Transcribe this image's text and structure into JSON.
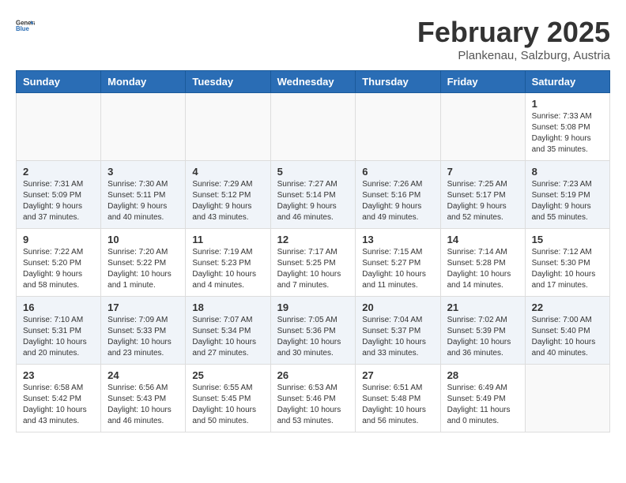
{
  "header": {
    "logo_general": "General",
    "logo_blue": "Blue",
    "title": "February 2025",
    "subtitle": "Plankenau, Salzburg, Austria"
  },
  "weekdays": [
    "Sunday",
    "Monday",
    "Tuesday",
    "Wednesday",
    "Thursday",
    "Friday",
    "Saturday"
  ],
  "weeks": [
    [
      {
        "day": "",
        "info": ""
      },
      {
        "day": "",
        "info": ""
      },
      {
        "day": "",
        "info": ""
      },
      {
        "day": "",
        "info": ""
      },
      {
        "day": "",
        "info": ""
      },
      {
        "day": "",
        "info": ""
      },
      {
        "day": "1",
        "info": "Sunrise: 7:33 AM\nSunset: 5:08 PM\nDaylight: 9 hours and 35 minutes."
      }
    ],
    [
      {
        "day": "2",
        "info": "Sunrise: 7:31 AM\nSunset: 5:09 PM\nDaylight: 9 hours and 37 minutes."
      },
      {
        "day": "3",
        "info": "Sunrise: 7:30 AM\nSunset: 5:11 PM\nDaylight: 9 hours and 40 minutes."
      },
      {
        "day": "4",
        "info": "Sunrise: 7:29 AM\nSunset: 5:12 PM\nDaylight: 9 hours and 43 minutes."
      },
      {
        "day": "5",
        "info": "Sunrise: 7:27 AM\nSunset: 5:14 PM\nDaylight: 9 hours and 46 minutes."
      },
      {
        "day": "6",
        "info": "Sunrise: 7:26 AM\nSunset: 5:16 PM\nDaylight: 9 hours and 49 minutes."
      },
      {
        "day": "7",
        "info": "Sunrise: 7:25 AM\nSunset: 5:17 PM\nDaylight: 9 hours and 52 minutes."
      },
      {
        "day": "8",
        "info": "Sunrise: 7:23 AM\nSunset: 5:19 PM\nDaylight: 9 hours and 55 minutes."
      }
    ],
    [
      {
        "day": "9",
        "info": "Sunrise: 7:22 AM\nSunset: 5:20 PM\nDaylight: 9 hours and 58 minutes."
      },
      {
        "day": "10",
        "info": "Sunrise: 7:20 AM\nSunset: 5:22 PM\nDaylight: 10 hours and 1 minute."
      },
      {
        "day": "11",
        "info": "Sunrise: 7:19 AM\nSunset: 5:23 PM\nDaylight: 10 hours and 4 minutes."
      },
      {
        "day": "12",
        "info": "Sunrise: 7:17 AM\nSunset: 5:25 PM\nDaylight: 10 hours and 7 minutes."
      },
      {
        "day": "13",
        "info": "Sunrise: 7:15 AM\nSunset: 5:27 PM\nDaylight: 10 hours and 11 minutes."
      },
      {
        "day": "14",
        "info": "Sunrise: 7:14 AM\nSunset: 5:28 PM\nDaylight: 10 hours and 14 minutes."
      },
      {
        "day": "15",
        "info": "Sunrise: 7:12 AM\nSunset: 5:30 PM\nDaylight: 10 hours and 17 minutes."
      }
    ],
    [
      {
        "day": "16",
        "info": "Sunrise: 7:10 AM\nSunset: 5:31 PM\nDaylight: 10 hours and 20 minutes."
      },
      {
        "day": "17",
        "info": "Sunrise: 7:09 AM\nSunset: 5:33 PM\nDaylight: 10 hours and 23 minutes."
      },
      {
        "day": "18",
        "info": "Sunrise: 7:07 AM\nSunset: 5:34 PM\nDaylight: 10 hours and 27 minutes."
      },
      {
        "day": "19",
        "info": "Sunrise: 7:05 AM\nSunset: 5:36 PM\nDaylight: 10 hours and 30 minutes."
      },
      {
        "day": "20",
        "info": "Sunrise: 7:04 AM\nSunset: 5:37 PM\nDaylight: 10 hours and 33 minutes."
      },
      {
        "day": "21",
        "info": "Sunrise: 7:02 AM\nSunset: 5:39 PM\nDaylight: 10 hours and 36 minutes."
      },
      {
        "day": "22",
        "info": "Sunrise: 7:00 AM\nSunset: 5:40 PM\nDaylight: 10 hours and 40 minutes."
      }
    ],
    [
      {
        "day": "23",
        "info": "Sunrise: 6:58 AM\nSunset: 5:42 PM\nDaylight: 10 hours and 43 minutes."
      },
      {
        "day": "24",
        "info": "Sunrise: 6:56 AM\nSunset: 5:43 PM\nDaylight: 10 hours and 46 minutes."
      },
      {
        "day": "25",
        "info": "Sunrise: 6:55 AM\nSunset: 5:45 PM\nDaylight: 10 hours and 50 minutes."
      },
      {
        "day": "26",
        "info": "Sunrise: 6:53 AM\nSunset: 5:46 PM\nDaylight: 10 hours and 53 minutes."
      },
      {
        "day": "27",
        "info": "Sunrise: 6:51 AM\nSunset: 5:48 PM\nDaylight: 10 hours and 56 minutes."
      },
      {
        "day": "28",
        "info": "Sunrise: 6:49 AM\nSunset: 5:49 PM\nDaylight: 11 hours and 0 minutes."
      },
      {
        "day": "",
        "info": ""
      }
    ]
  ]
}
